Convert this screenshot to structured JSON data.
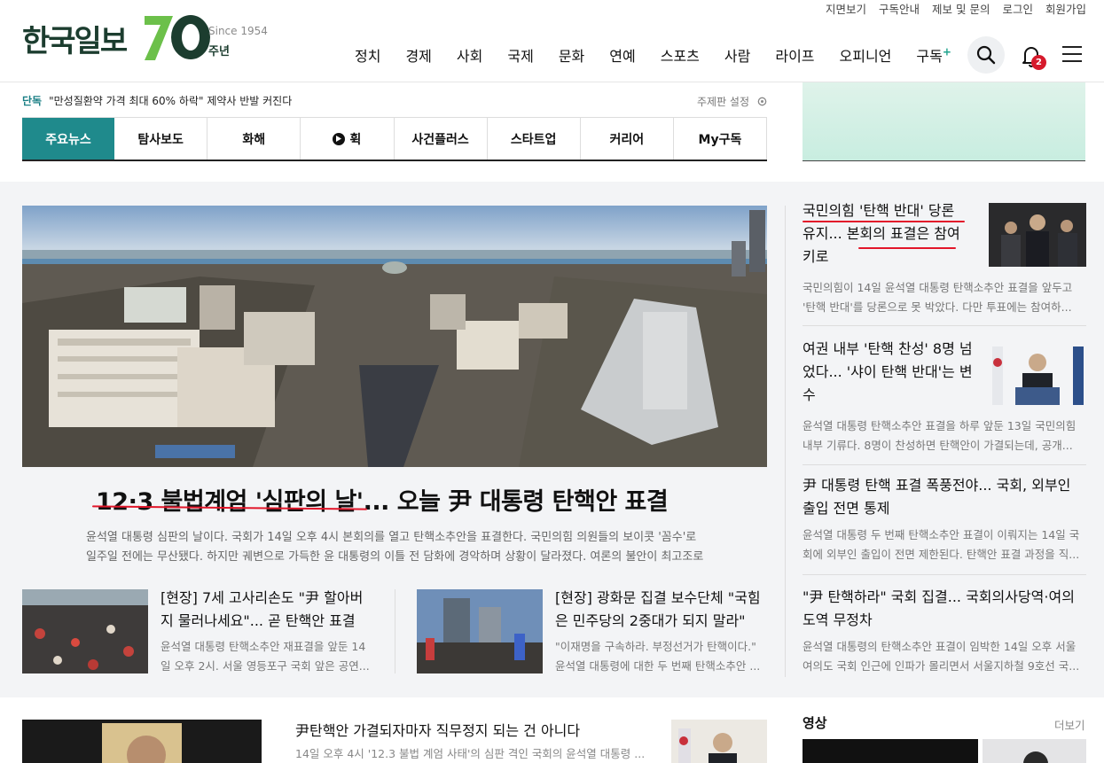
{
  "util_links": [
    "지면보기",
    "구독안내",
    "제보 및 문의",
    "로그인",
    "회원가입"
  ],
  "logo": {
    "name": "한국일보",
    "since": "Since 1954",
    "anniv": "주년"
  },
  "nav": [
    "정치",
    "경제",
    "사회",
    "국제",
    "문화",
    "연예",
    "스포츠",
    "사람",
    "라이프",
    "오피니언",
    "구독"
  ],
  "nav_plus": "+",
  "notification_count": "2",
  "icons": {
    "search": "search-icon",
    "bell": "bell-icon",
    "menu": "hamburger-menu-icon",
    "gear": "gear-icon",
    "play": "play-icon"
  },
  "breaking": {
    "tag": "단독",
    "text": "\"만성질환약 가격 최대 60% 하락\" 제약사 반발 커진다"
  },
  "edition_setting": "주제판 설정",
  "tabs": [
    "주요뉴스",
    "탐사보도",
    "화해",
    "휙",
    "사건플러스",
    "스타트업",
    "커리어",
    "My구독"
  ],
  "hero": {
    "title": "12·3 불법계엄 '심판의 날'... 오늘 尹 대통령 탄핵안 표결",
    "summary": "윤석열 대통령 심판의 날이다. 국회가 14일 오후 4시 본회의를 열고 탄핵소추안을 표결한다. 국민의힘 의원들의 보이콧 '꼼수'로 일주일 전에는 무산됐다. 하지만 궤변으로 가득한 윤 대통령의 이틀 전 담화에 경악하며 상황이 달라졌다. 여론의 불안이 최고조로 ..."
  },
  "sub_articles": [
    {
      "title": "[현장] 7세 고사리손도 \"尹 할아버지 물러나세요\"... 곧 탄핵안 표결",
      "summary": "윤석열 대통령 탄핵소추안 재표결을 앞둔 14일 오후 2시. 서울 영등포구 국회 앞은 공연..."
    },
    {
      "title": "[현장] 광화문 집결 보수단체 \"국힘은 민주당의 2중대가 되지 말라\"",
      "summary": "\"이재명을 구속하라. 부정선거가 탄핵이다.\" 윤석열 대통령에 대한 두 번째 탄핵소추안 ..."
    }
  ],
  "right_articles": [
    {
      "title": "국민의힘 '탄핵 반대' 당론 유지... 본회의 표결은 참여키로",
      "summary": "국민의힘이 14일 윤석열 대통령 탄핵소추안 표결을 앞두고 '탄핵 반대'를 당론으로 못 박았다. 다만 투표에는 참여하..."
    },
    {
      "title": "여권 내부 '탄핵 찬성' 8명 넘었다... '샤이 탄핵 반대'는 변수",
      "summary": "윤석열 대통령 탄핵소추안 표결을 하루 앞둔 13일 국민의힘 내부 기류다. 8명이 찬성하면 탄핵안이 가결되는데, 공개..."
    },
    {
      "title": "尹 대통령 탄핵 표결 폭풍전야... 국회, 외부인 출입 전면 통제",
      "summary": "윤석열 대통령 두 번째 탄핵소추안 표결이 이뤄지는 14일 국회에 외부인 출입이 전면 제한된다. 탄핵안 표결 과정을 직..."
    },
    {
      "title": "\"尹 탄핵하라\" 국회 집결... 국회의사당역·여의도역 무정차",
      "summary": "윤석열 대통령의 탄핵소추안 표결이 임박한 14일 오후 서울 여의도 국회 인근에 인파가 몰리면서 서울지하철 9호선 국..."
    }
  ],
  "bottom_article": {
    "title": "尹탄핵안 가결되자마자 직무정지 되는 건 아니다",
    "summary": "14일 오후 4시 '12.3 불법 계엄 사태'의 심판 격인 국회의 윤석열 대통령 ..."
  },
  "video_section": {
    "title": "영상",
    "more": "더보기"
  },
  "colors": {
    "accent": "#1f8a8c",
    "brand": "#1c3d2f",
    "logo_green": "#6cc04a",
    "badge": "#d61a2c",
    "underline": "#e2162a"
  }
}
